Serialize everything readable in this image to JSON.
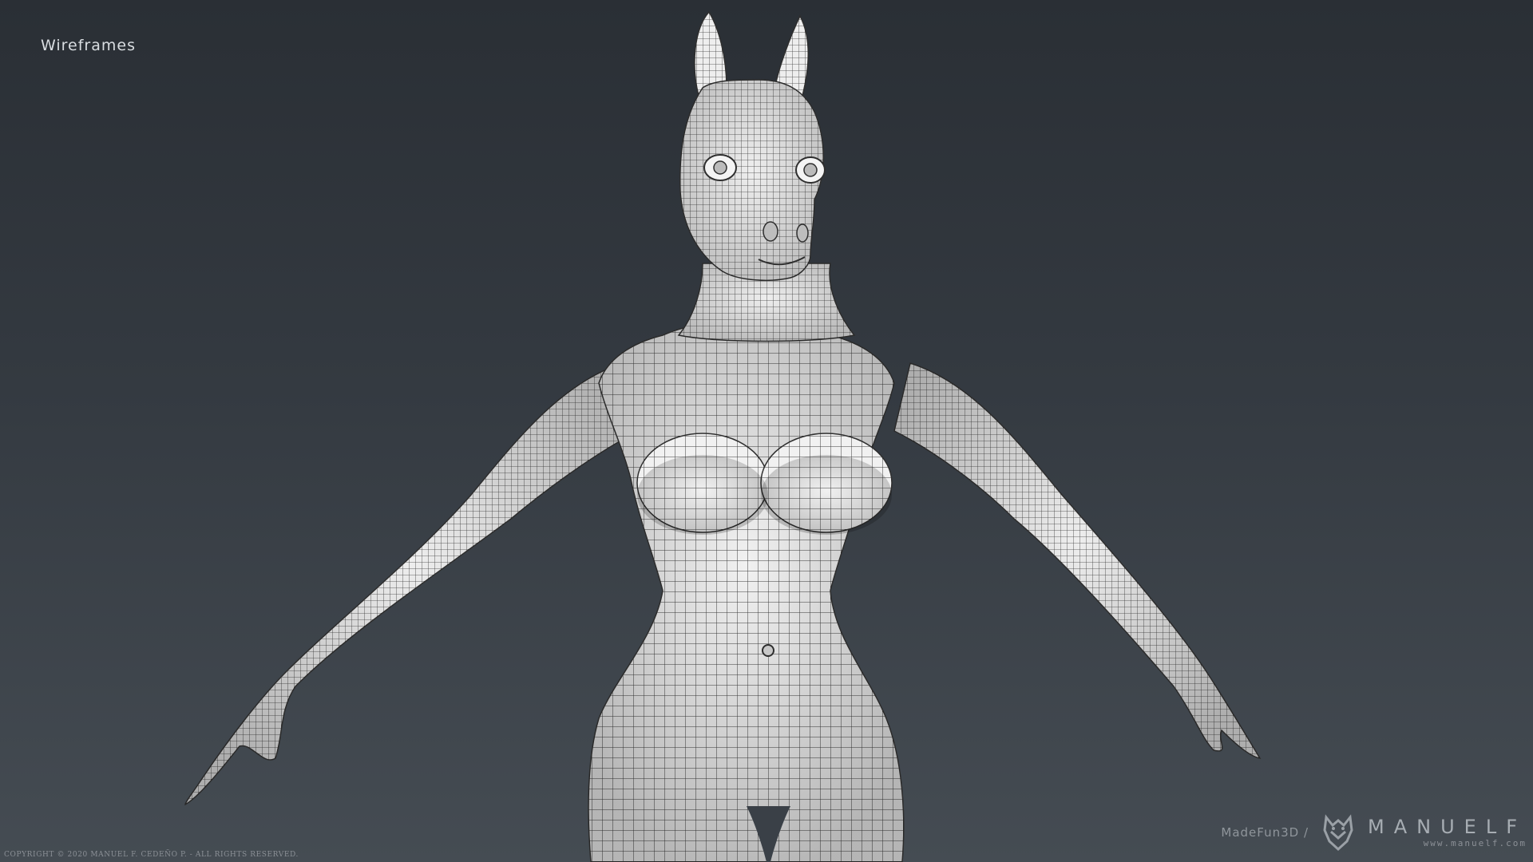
{
  "title": "Wireframes",
  "copyright": "COPYRIGHT © 2020 MANUEL F. CEDEÑO P. - ALL RIGHTS RESERVED.",
  "brand": {
    "studio": "MadeFun3D /",
    "name": "MANUELF",
    "url": "www.manuelf.com",
    "logo_icon": "manuelf-logo"
  },
  "colors": {
    "background_top": "#2a2f35",
    "background_bottom": "#454c53",
    "model_surface": "#ececec",
    "wire_lines": "#3c3c3c"
  }
}
